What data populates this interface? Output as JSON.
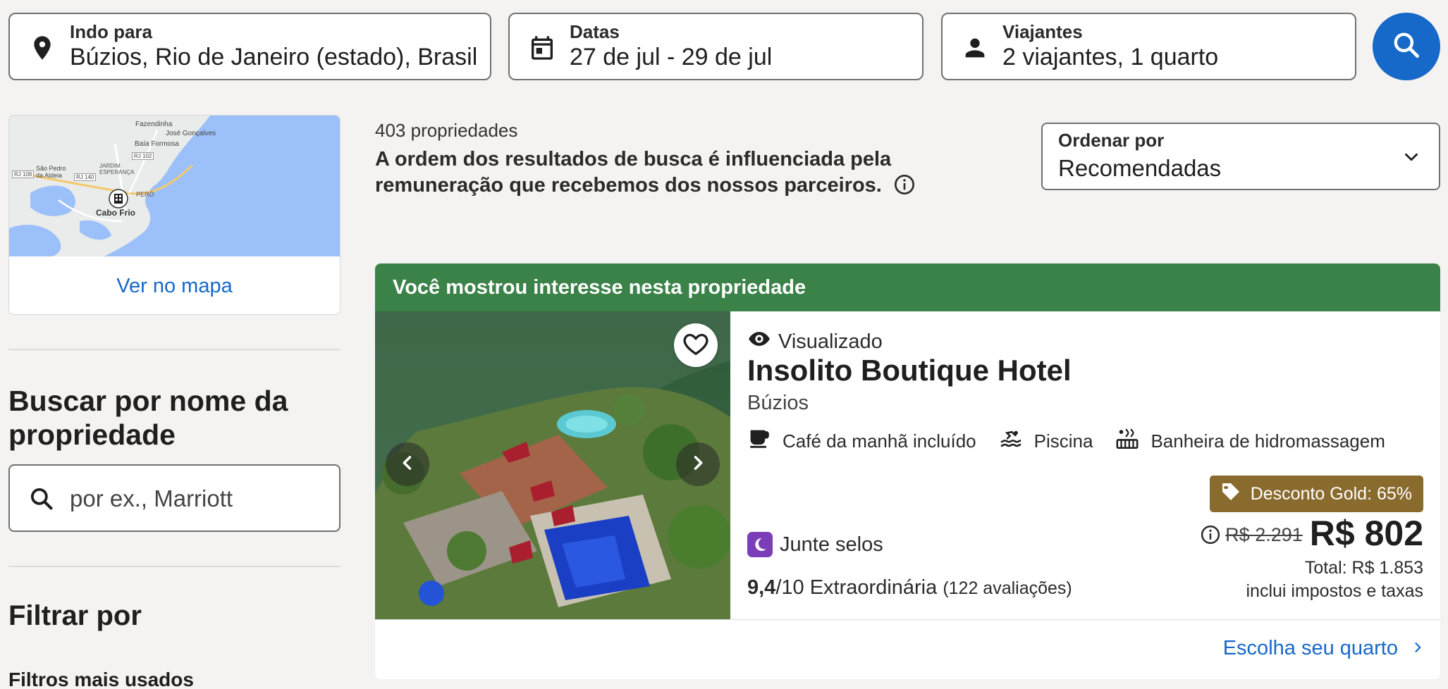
{
  "search": {
    "destination_label": "Indo para",
    "destination_value": "Búzios, Rio de Janeiro (estado), Brasil",
    "dates_label": "Datas",
    "dates_value": "27 de jul - 29 de jul",
    "travelers_label": "Viajantes",
    "travelers_value": "2 viajantes, 1 quarto",
    "button_icon": "search-icon"
  },
  "map": {
    "link": "Ver no mapa",
    "labels": [
      "Fazendinha",
      "José Gonçalves",
      "Baía Formosa",
      "São Pedro da Aldeia",
      "JARDIM ESPERANÇA",
      "PERÓ",
      "Cabo Frio",
      "RJ 140",
      "RJ 102",
      "RJ 106"
    ]
  },
  "sidebar": {
    "name_search_title": "Buscar por nome da propriedade",
    "name_search_placeholder": "por ex., Marriott",
    "filter_title": "Filtrar por",
    "popular_filters": "Filtros mais usados"
  },
  "results": {
    "count": "403 propriedades",
    "disclaimer": "A ordem dos resultados de busca é influenciada pela remuneração que recebemos dos nossos parceiros.",
    "sort_label": "Ordenar por",
    "sort_value": "Recomendadas"
  },
  "property": {
    "banner": "Você mostrou interesse nesta propriedade",
    "viewed": "Visualizado",
    "name": "Insolito Boutique Hotel",
    "city": "Búzios",
    "amenities": [
      "Café da manhã incluído",
      "Piscina",
      "Banheira de hidromassagem"
    ],
    "stamps": "Junte selos",
    "rating_score": "9,4",
    "rating_scale": "/10",
    "rating_text": "Extraordinária",
    "reviews": "(122 avaliações)",
    "discount": "Desconto Gold: 65%",
    "old_price": "R$ 2.291",
    "price": "R$ 802",
    "total": "Total: R$ 1.853",
    "taxes": "inclui impostos e taxas",
    "choose_room": "Escolha seu quarto"
  },
  "colors": {
    "brand_blue": "#1668c9",
    "banner_green": "#3b8249",
    "discount_gold": "#8a6b2e",
    "stamp_purple": "#7b3db8"
  }
}
